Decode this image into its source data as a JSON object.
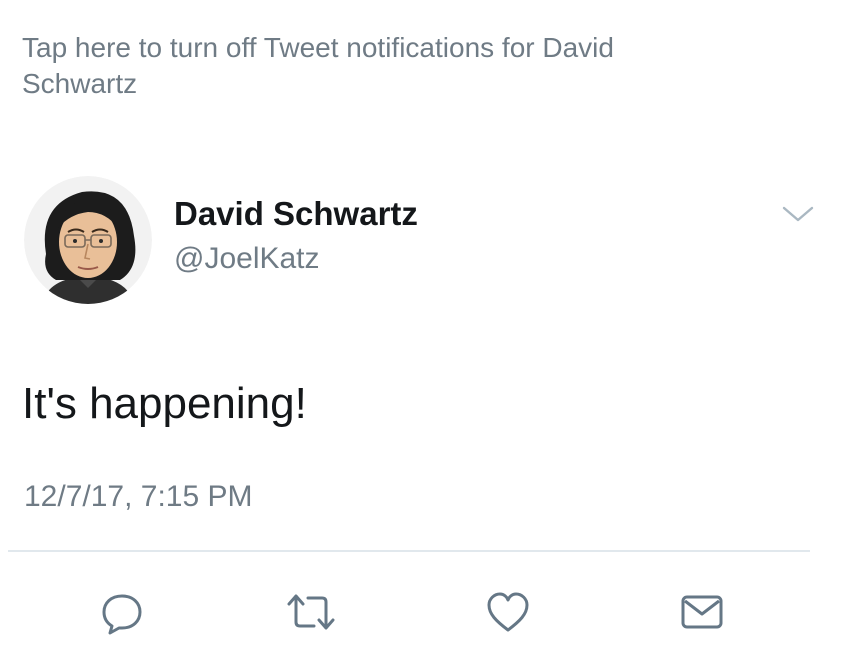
{
  "banner": {
    "text": "Tap here to turn off Tweet notifications for David Schwartz"
  },
  "tweet": {
    "display_name": "David Schwartz",
    "handle": "@JoelKatz",
    "text": "It's happening!",
    "timestamp": "12/7/17, 7:15 PM"
  },
  "actions": [
    {
      "icon": "reply-icon"
    },
    {
      "icon": "retweet-icon"
    },
    {
      "icon": "heart-icon"
    },
    {
      "icon": "message-icon"
    }
  ],
  "colors": {
    "primary_text": "#14171a",
    "secondary_text": "#6f7b85",
    "icon_gray": "#657786",
    "divider": "#e1e8ed"
  }
}
